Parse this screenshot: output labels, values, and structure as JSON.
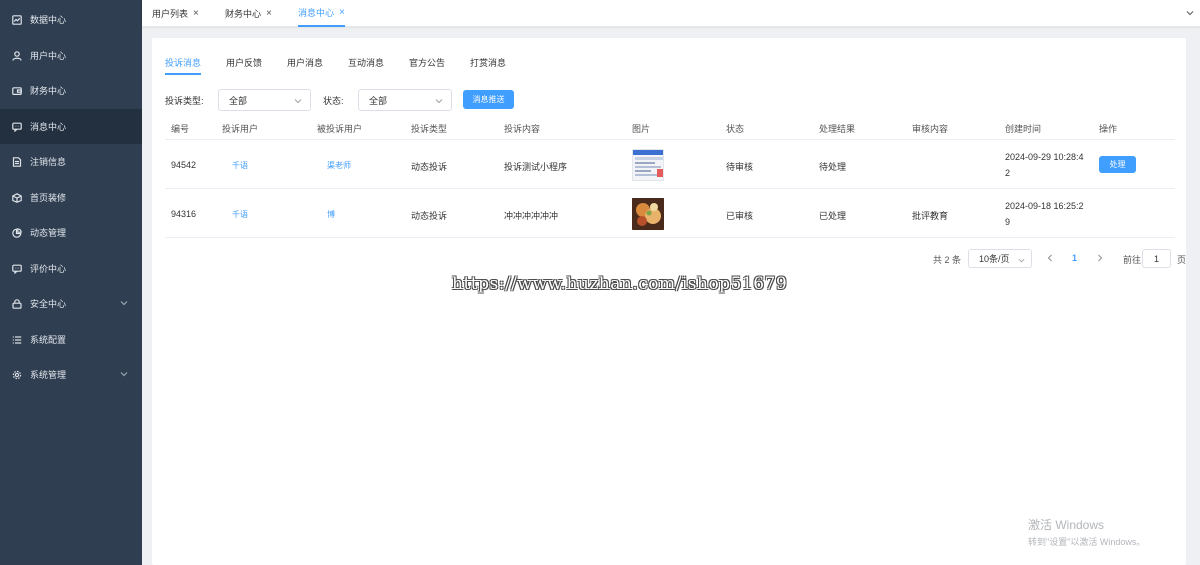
{
  "sidebar": {
    "items": [
      {
        "label": "数据中心",
        "icon": "chart-icon"
      },
      {
        "label": "用户中心",
        "icon": "user-icon"
      },
      {
        "label": "财务中心",
        "icon": "wallet-icon"
      },
      {
        "label": "消息中心",
        "icon": "message-icon",
        "active": true
      },
      {
        "label": "注销信息",
        "icon": "document-icon"
      },
      {
        "label": "首页装修",
        "icon": "box-icon"
      },
      {
        "label": "动态管理",
        "icon": "pie-icon"
      },
      {
        "label": "评价中心",
        "icon": "comment-icon"
      },
      {
        "label": "安全中心",
        "icon": "lock-icon",
        "expandable": true
      },
      {
        "label": "系统配置",
        "icon": "list-icon"
      },
      {
        "label": "系统管理",
        "icon": "gear-icon",
        "expandable": true
      }
    ]
  },
  "tabs": [
    {
      "label": "用户列表",
      "close": "×"
    },
    {
      "label": "财务中心",
      "close": "×"
    },
    {
      "label": "消息中心",
      "close": "×",
      "active": true
    }
  ],
  "subtabs": [
    "投诉消息",
    "用户反馈",
    "用户消息",
    "互动消息",
    "官方公告",
    "打赏消息"
  ],
  "filters": {
    "type_label": "投诉类型:",
    "type_value": "全部",
    "status_label": "状态:",
    "status_value": "全部",
    "push_button": "消息推送"
  },
  "table": {
    "headers": [
      "编号",
      "投诉用户",
      "被投诉用户",
      "投诉类型",
      "投诉内容",
      "图片",
      "状态",
      "处理结果",
      "审核内容",
      "创建时间",
      "操作"
    ],
    "rows": [
      {
        "id": "94542",
        "user": "千语",
        "target": "渠老师",
        "type": "动态投诉",
        "content": "投诉测试小程序",
        "image": "screenshot-thumbnail",
        "status": "待审核",
        "result": "待处理",
        "review": "",
        "created_line1": "2024-09-29 10:28:4",
        "created_line2": "2",
        "action": "处理"
      },
      {
        "id": "94316",
        "user": "千语",
        "target": "博",
        "type": "动态投诉",
        "content": "冲冲冲冲冲冲",
        "image": "food-photo-thumbnail",
        "status": "已审核",
        "result": "已处理",
        "review": "批评教育",
        "created_line1": "2024-09-18 16:25:2",
        "created_line2": "9",
        "action": ""
      }
    ]
  },
  "pagination": {
    "total": "共 2 条",
    "page_size": "10条/页",
    "current_page": "1",
    "goto_label": "前往",
    "goto_value": "1",
    "page_suffix": "页"
  },
  "watermark": "https://www.huzhan.com/ishop51679",
  "windows_activation": {
    "title": "激活 Windows",
    "subtitle": "转到\"设置\"以激活 Windows。"
  },
  "colors": {
    "sidebar_bg": "#2f3e50",
    "sidebar_active_bg": "#223040",
    "accent": "#409eff"
  }
}
